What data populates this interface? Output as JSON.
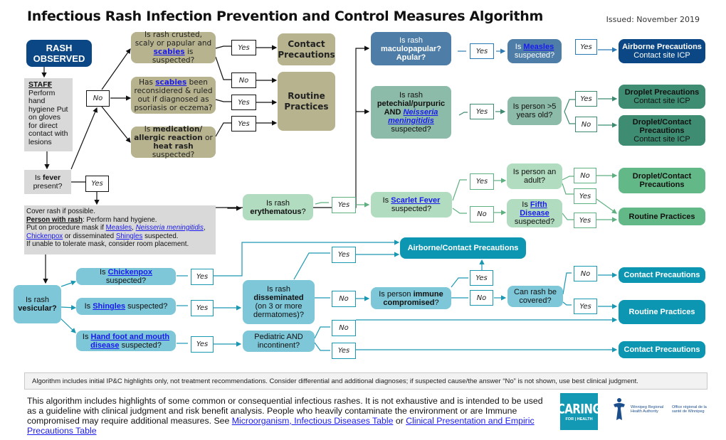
{
  "header": {
    "title": "Infectious Rash Infection Prevention and Control Measures Algorithm",
    "issued": "Issued: November 2019"
  },
  "colors": {
    "navy": "#0b4784",
    "olive": "#b6b38e",
    "steel_blue": "#4e7ea8",
    "teal": "#8dbba9",
    "teal_dark": "#3e8c72",
    "green_light": "#b2dcc0",
    "green_dark": "#62b886",
    "cyan_light": "#7dc7d8",
    "cyan_dark": "#0d96b2",
    "grey": "#d9d9d9",
    "link": "#1a1aee"
  },
  "start": {
    "line1": "RASH",
    "line2": "OBSERVED"
  },
  "staff": {
    "heading": "STAFF",
    "text": "Perform hand hygiene Put on gloves for direct contact with lesions"
  },
  "fever": {
    "pre": "Is ",
    "bold": "fever",
    "post": " present?"
  },
  "person_box": {
    "line1": "Cover rash if possible.",
    "line2_bold": "Person with rash",
    "line2_rest": ": Perform hand hygiene.",
    "line3_pre": "Put on procedure mask if ",
    "link_measles": "Measles",
    "sep1": ", ",
    "link_neisseria": "Neisseria meningitidis",
    "sep2": ",",
    "link_chickenpox": "Chickenpox",
    "line4_mid": " or disseminated ",
    "link_shingles": "Shingles",
    "line4_end": " suspected.",
    "line5": "If unable to tolerate mask, consider room placement."
  },
  "answers": {
    "yes": "Yes",
    "no": "No"
  },
  "olive_branch": {
    "q1_pre": "Is rash crusted, scaly or papular and ",
    "q1_link": "scabies",
    "q1_post": " is suspected?",
    "q2_pre": "Has ",
    "q2_link": "scabies",
    "q2_post": " been reconsidered & ruled out if diagnosed as psoriasis or eczema?",
    "q3_pre": "Is ",
    "q3_bold1": "medication/ allergic reaction",
    "q3_mid": " or ",
    "q3_bold2": "heat rash",
    "q3_post": " suspected?",
    "contact": "Contact Precautions",
    "routine": "Routine Practices"
  },
  "maculopapular": {
    "q_line1": "Is rash",
    "q_line2": "maculopapular?",
    "q_line3": "Apular?",
    "measles_pre": "Is ",
    "measles_link": "Measles",
    "measles_post": "suspected?",
    "result_title": "Airborne Precautions",
    "result_sub": "Contact site ICP"
  },
  "petechial": {
    "q_line1": "Is rash",
    "q_line2": "petechial/purpuric",
    "q_and": "AND ",
    "q_link": "Neisseria meningitidis",
    "q_post": "suspected?",
    "age_q": "Is person >5 years old?",
    "result_yes_title": "Droplet Precautions",
    "result_yes_sub": "Contact site ICP",
    "result_no_title": "Droplet/Contact Precautions",
    "result_no_sub": "Contact site ICP"
  },
  "erythematous": {
    "q_line1": "Is rash",
    "q_bold": "erythematous",
    "q_post": "?",
    "scarlet_pre": "Is ",
    "scarlet_link": "Scarlet Fever",
    "scarlet_post": "suspected?",
    "adult_q": "Is person an adult?",
    "fifth_pre": "Is ",
    "fifth_link": "Fifth Disease",
    "fifth_post": "suspected?",
    "result_droplet": "Droplet/Contact Precautions",
    "result_routine": "Routine Practices"
  },
  "vesicular": {
    "q_line1": "Is rash",
    "q_bold": "vesicular?",
    "chickenpox_pre": "Is ",
    "chickenpox_link": "Chickenpox",
    "chickenpox_post": " suspected?",
    "shingles_pre": "Is ",
    "shingles_link": "Shingles",
    "shingles_post": " suspected?",
    "hfm_pre": "Is ",
    "hfm_link": "Hand foot and mouth disease",
    "hfm_post": " suspected?",
    "disseminated_line1": "Is rash",
    "disseminated_bold": "disseminated",
    "disseminated_post": "(on 3 or more dermatomes)?",
    "pediatric_q": "Pediatric AND incontinent?",
    "immune_pre": "Is person ",
    "immune_bold": "immune compromised",
    "immune_post": "?",
    "covered_q": "Can rash be covered?",
    "result_airborne_contact": "Airborne/Contact Precautions",
    "result_contact_1": "Contact Precautions",
    "result_routine": "Routine Practices",
    "result_contact_2": "Contact Precautions"
  },
  "note": "Algorithm includes initial IP&C highlights only, not treatment recommendations. Consider differential and additional diagnoses; if suspected cause/the answer “No” is not shown, use best clinical judgment.",
  "footer": {
    "text": "This algorithm includes highlights of some common or consequential infectious rashes. It is not exhaustive and is intended to be used as a guideline with clinical judgment and risk benefit analysis. People who heavily contaminate the environment or are Immune compromised may require additional measures. See ",
    "link1": "Microorganism, Infectious Diseases Table",
    "or": " or ",
    "link2": "Clinical Presentation and Empiric Precautions Table"
  },
  "logos": {
    "caring_big": "CARING",
    "caring_small": "FOR | HEALTH",
    "wrha_en": "Winnipeg Regional Health Authority",
    "wrha_fr": "Office régional de la santé de Winnipeg"
  }
}
